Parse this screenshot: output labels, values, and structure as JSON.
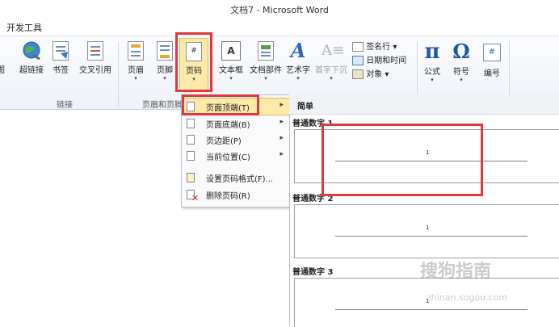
{
  "window": {
    "title": "文档7 - Microsoft Word"
  },
  "tab": {
    "label": "开发工具"
  },
  "ribbon": {
    "buttons": [
      {
        "id": "picture",
        "label": "图",
        "icon": "picture-icon"
      },
      {
        "id": "hyperlink",
        "label": "超链接",
        "icon": "globe-link-icon"
      },
      {
        "id": "bookmark",
        "label": "书签",
        "icon": "bookmark-icon"
      },
      {
        "id": "crossref",
        "label": "交叉引用",
        "icon": "crossref-icon"
      },
      {
        "id": "header",
        "label": "页眉",
        "icon": "header-icon"
      },
      {
        "id": "footer",
        "label": "页脚",
        "icon": "footer-icon"
      },
      {
        "id": "pagenumber",
        "label": "页码",
        "icon": "page-number-icon"
      },
      {
        "id": "textbox",
        "label": "文本框",
        "icon": "textbox-icon"
      },
      {
        "id": "quickparts",
        "label": "文档部件",
        "icon": "quickparts-icon"
      },
      {
        "id": "wordart",
        "label": "艺术字",
        "icon": "wordart-icon"
      },
      {
        "id": "dropcap",
        "label": "首字下沉",
        "icon": "dropcap-icon"
      },
      {
        "id": "equation",
        "label": "公式",
        "icon": "pi-icon"
      },
      {
        "id": "symbol",
        "label": "符号",
        "icon": "omega-icon"
      },
      {
        "id": "number",
        "label": "编号",
        "icon": "number-icon"
      }
    ],
    "small_buttons": [
      {
        "label": "签名行 ▾",
        "icon": "signature-icon"
      },
      {
        "label": "日期和时间",
        "icon": "calendar-icon"
      },
      {
        "label": "对象 ▾",
        "icon": "object-icon"
      }
    ],
    "groups": {
      "links": "链接",
      "header_footer": "页眉和页脚"
    }
  },
  "page_number_menu": {
    "items": [
      {
        "label": "页面顶端(T)",
        "has_submenu": true
      },
      {
        "label": "页面底端(B)",
        "has_submenu": true
      },
      {
        "label": "页边距(P)",
        "has_submenu": true
      },
      {
        "label": "当前位置(C)",
        "has_submenu": true
      },
      {
        "label": "设置页码格式(F)...",
        "has_submenu": false
      },
      {
        "label": "删除页码(R)",
        "has_submenu": false
      }
    ]
  },
  "gallery": {
    "header": "简单",
    "items": [
      {
        "title": "普通数字 1",
        "number": "1"
      },
      {
        "title": "普通数字 2",
        "number": "1"
      },
      {
        "title": "普通数字 3",
        "number": "1"
      }
    ]
  },
  "watermark": {
    "text": "搜狗指南",
    "url": "zhinan.sogou.com"
  },
  "colors": {
    "highlight": "#e0383c",
    "selected_bg": "#fde9a8"
  }
}
